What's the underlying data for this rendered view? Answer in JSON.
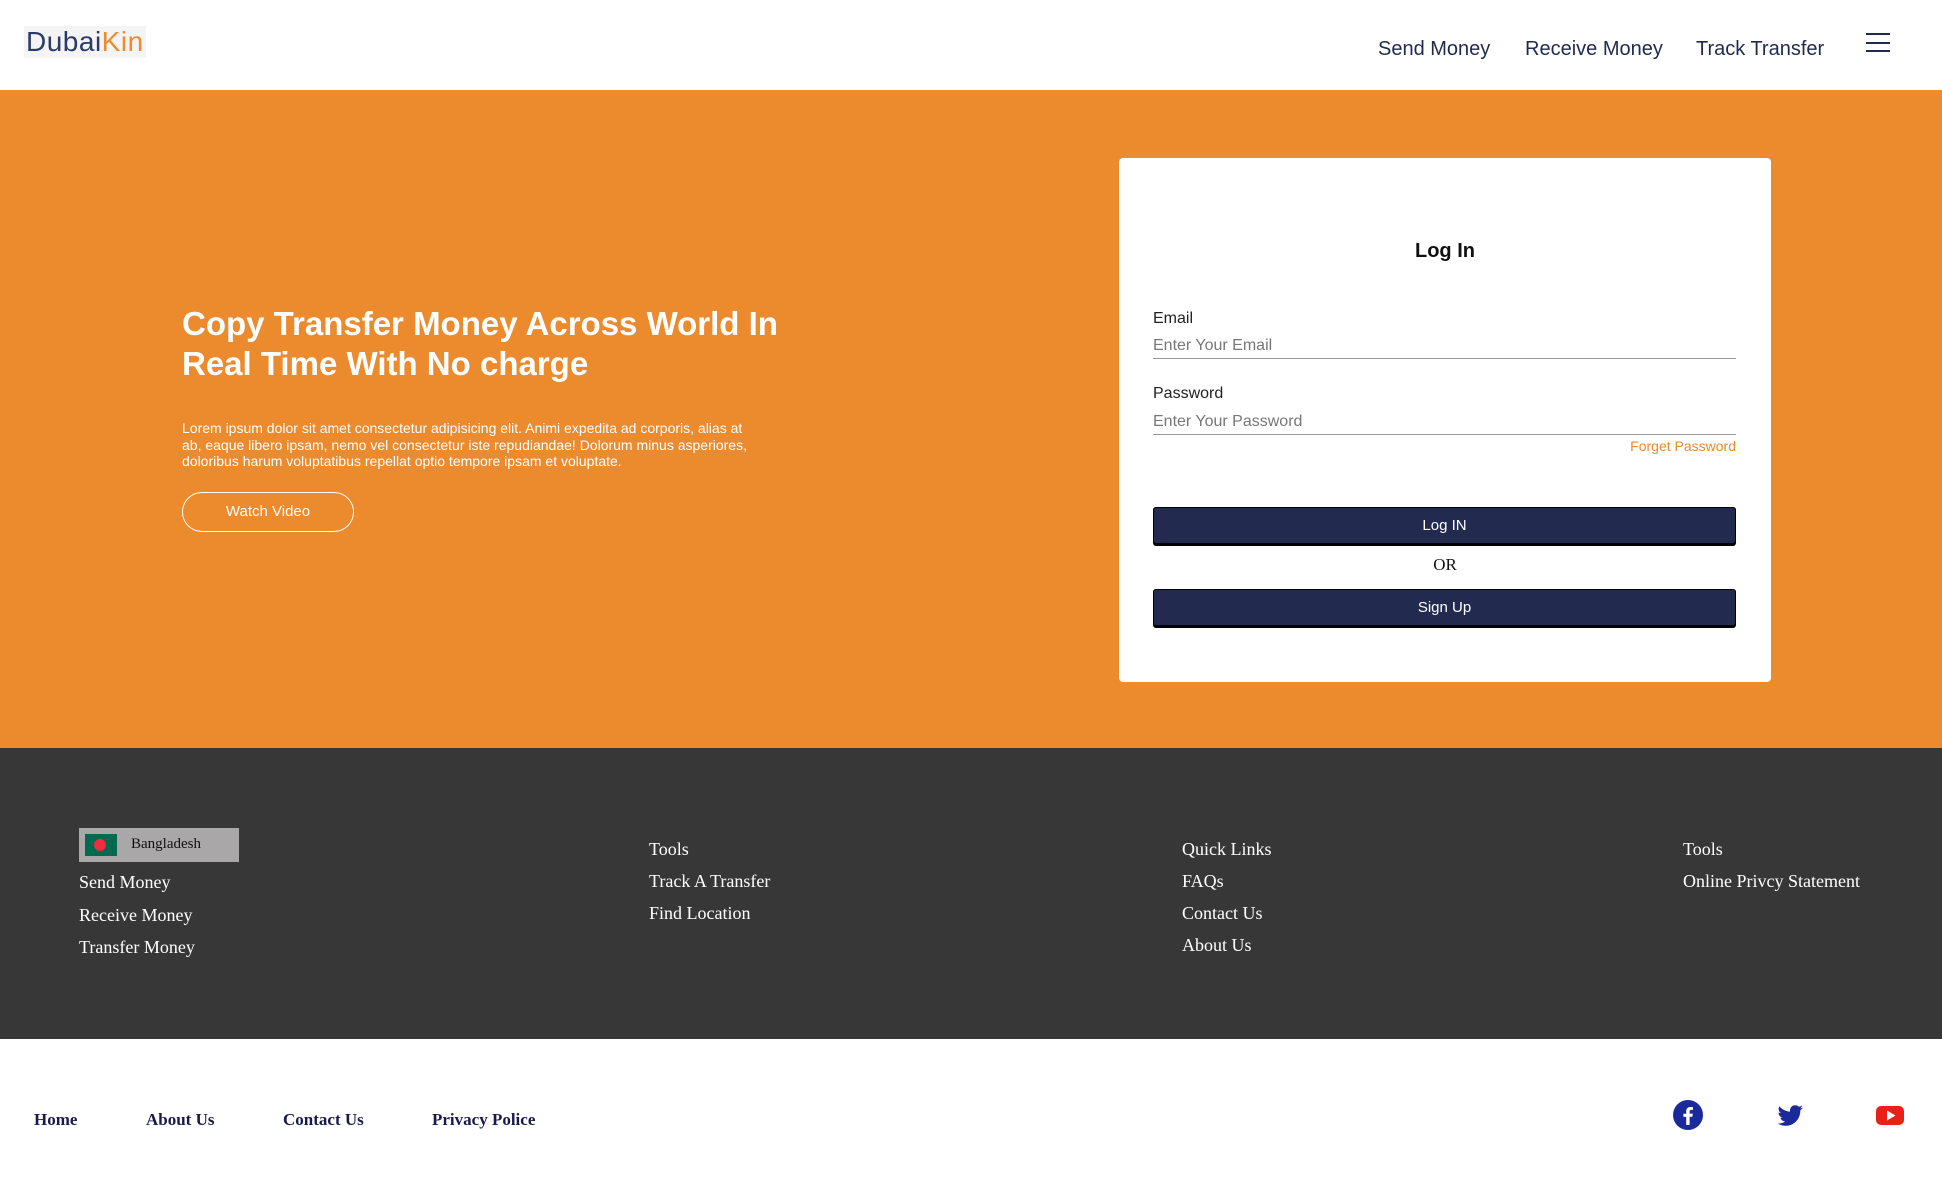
{
  "header": {
    "logo_part1": "Dubai",
    "logo_part2": "Kin",
    "nav": [
      "Send Money",
      "Receive Money",
      "Track Transfer"
    ],
    "menu_icon": "hamburger-icon"
  },
  "hero": {
    "title": "Copy Transfer Money Across World In Real Time With No charge",
    "text": "Lorem ipsum dolor sit amet consectetur adipisicing elit. Animi expedita ad corporis, alias at ab, eaque libero ipsam, nemo vel consectetur iste repudiandae! Dolorum minus asperiores, doloribus harum voluptatibus repellat optio tempore ipsam et voluptate.",
    "watch_label": "Watch Video",
    "background_color": "#ec8a2e"
  },
  "login": {
    "title": "Log In",
    "email_label": "Email",
    "email_placeholder": "Enter Your Email",
    "email_value": "",
    "password_label": "Password",
    "password_placeholder": "Enter Your Password",
    "password_value": "",
    "forget_label": "Forget Password",
    "login_button": "Log IN",
    "or_label": "OR",
    "signup_button": "Sign Up",
    "button_color": "#222b4f"
  },
  "footer": {
    "country": "Bangladesh",
    "col1": [
      "Send Money",
      "Receive Money",
      "Transfer Money"
    ],
    "col2": [
      "Tools",
      "Track A Transfer",
      "Find Location"
    ],
    "col3": [
      "Quick Links",
      "FAQs",
      "Contact Us",
      "About Us"
    ],
    "col4": [
      "Tools",
      "Online Privcy Statement"
    ],
    "background_color": "#373737"
  },
  "bottom": {
    "links": [
      "Home",
      "About Us",
      "Contact Us",
      "Privacy Police"
    ],
    "social": [
      "facebook-icon",
      "twitter-icon",
      "youtube-icon"
    ]
  }
}
